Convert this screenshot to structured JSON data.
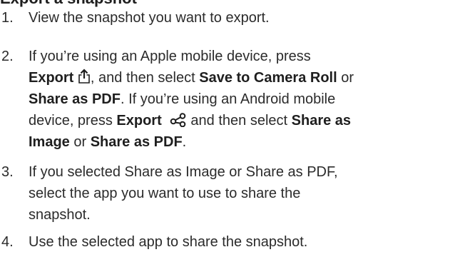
{
  "heading": "Export a snapshot",
  "steps": [
    {
      "number": "1.",
      "text": "View the snapshot you want to export."
    },
    {
      "number": "2.",
      "line1": "If you’re using an Apple mobile device, press",
      "export_label": "Export",
      "after_apple_icon": ", and then select ",
      "save_to_camera_roll": "Save to Camera Roll",
      "or_1": " or",
      "share_as_pdf_1": "Share as PDF",
      "android_sentence": ". If you’re using an Android mobile",
      "line4_start": "device, press ",
      "export_label_2": "Export",
      "after_android_icon": " and then select ",
      "share_as_1": "Share as",
      "image_word": "Image",
      "or_2": " or ",
      "share_as_pdf_2": "Share as PDF",
      "period": "."
    },
    {
      "number": "3.",
      "line1": "If you selected Share as Image or Share as PDF,",
      "line2": "select the app you want to use to share the",
      "line3": "snapshot."
    },
    {
      "number": "4.",
      "text": "Use the selected app to share the snapshot."
    }
  ],
  "icons": {
    "apple_export": "share-upload-icon",
    "android_export": "share-nodes-icon"
  },
  "colors": {
    "text": "#2b2b2b",
    "bold_text": "#1e1e1e"
  }
}
